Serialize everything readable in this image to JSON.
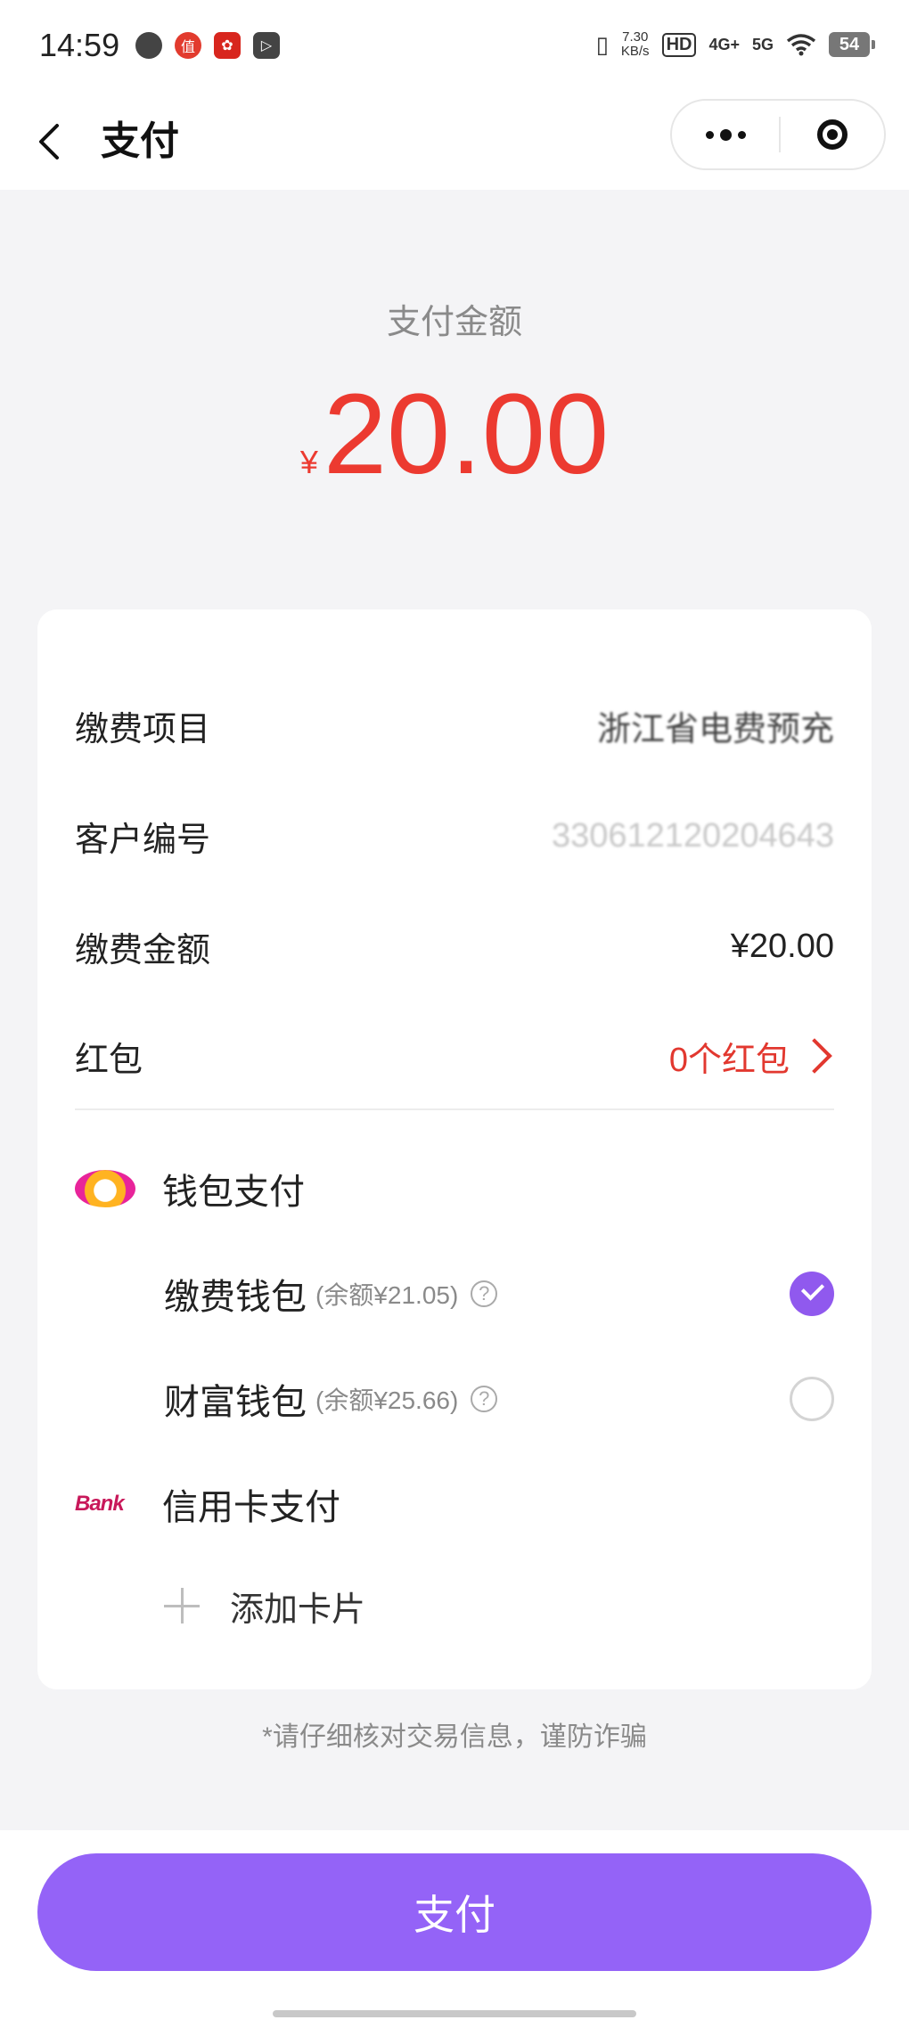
{
  "status_bar": {
    "time": "14:59",
    "left_icons": [
      "chat-bubble-icon",
      "worth-buying-app-icon",
      "lucky-app-icon",
      "play-app-icon"
    ],
    "speed_value": "7.30",
    "speed_unit": "KB/s",
    "hd_badge": "HD",
    "net1": "4G+",
    "net2": "5G",
    "battery": "54"
  },
  "nav": {
    "title": "支付"
  },
  "amount_label": "支付金额",
  "amount": {
    "currency": "¥",
    "value": "20.00"
  },
  "details": {
    "item_label": "缴费项目",
    "item_value": "浙江省电费预充",
    "customer_label": "客户编号",
    "customer_value": "330612120204643",
    "fee_label": "缴费金额",
    "fee_value": "¥20.00",
    "redpacket_label": "红包",
    "redpacket_value": "0个红包"
  },
  "wallet": {
    "title": "钱包支付",
    "options": [
      {
        "name": "缴费钱包",
        "balance": "(余额¥21.05)",
        "help": "?",
        "selected": true
      },
      {
        "name": "财富钱包",
        "balance": "(余额¥25.66)",
        "help": "?",
        "selected": false
      }
    ]
  },
  "credit": {
    "logo": "Bank",
    "title": "信用卡支付",
    "add_card": "添加卡片"
  },
  "notice": "*请仔细核对交易信息，谨防诈骗",
  "pay_button": "支付",
  "colors": {
    "accent": "#9463f7",
    "amount_red": "#ec3a30",
    "background": "#f4f4f6"
  }
}
